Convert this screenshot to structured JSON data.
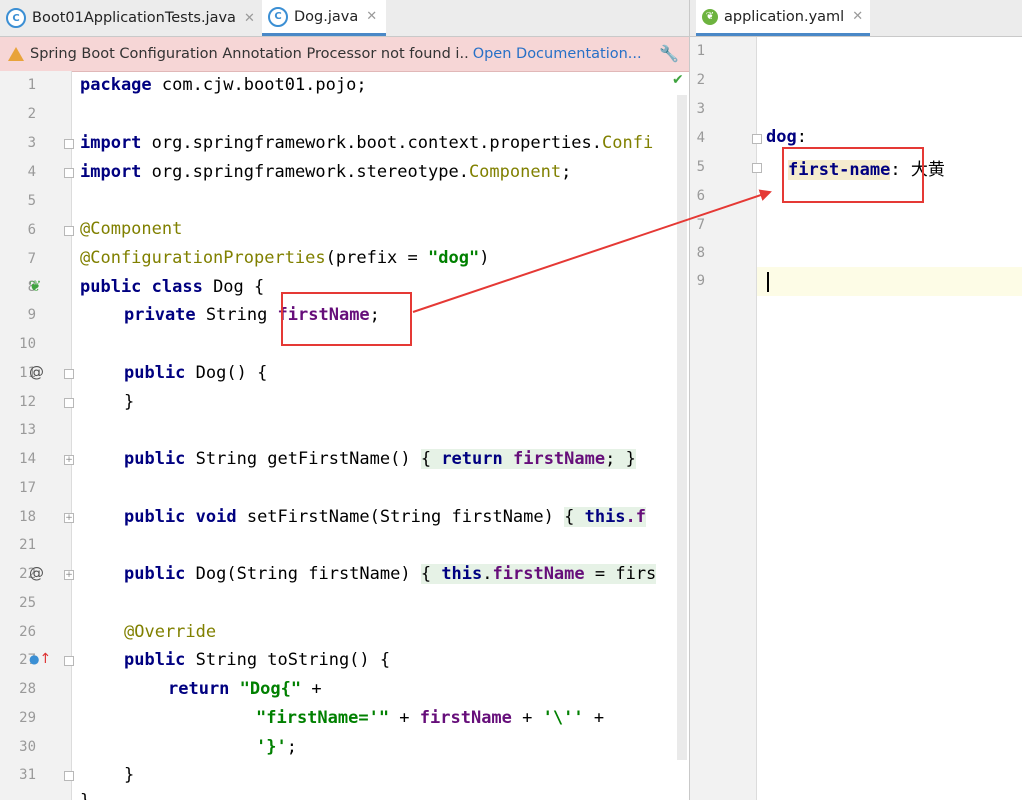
{
  "left_tabs": [
    {
      "label": "Boot01ApplicationTests.java",
      "icon": "class-icon",
      "active": false
    },
    {
      "label": "Dog.java",
      "icon": "class-icon",
      "active": true
    }
  ],
  "right_tabs": [
    {
      "label": "application.yaml",
      "icon": "spring-leaf-icon",
      "active": true
    }
  ],
  "notification": {
    "message": "Spring Boot Configuration Annotation Processor not found i..",
    "link": "Open Documentation..."
  },
  "left_lines": [
    "1",
    "2",
    "3",
    "4",
    "5",
    "6",
    "7",
    "8",
    "9",
    "10",
    "11",
    "12",
    "13",
    "14",
    "17",
    "18",
    "21",
    "22",
    "25",
    "26",
    "27",
    "28",
    "29",
    "30",
    "31"
  ],
  "code": {
    "l1a": "package",
    "l1b": " com.cjw.boot01.pojo;",
    "l3a": "import",
    "l3b": " org.springframework.boot.context.properties.",
    "l3c": "Confi",
    "l4a": "import",
    "l4b": " org.springframework.stereotype.",
    "l4c": "Component",
    "l4d": ";",
    "l6": "@Component",
    "l7a": "@ConfigurationProperties",
    "l7b": "(prefix = ",
    "l7c": "\"dog\"",
    "l7d": ")",
    "l8a": "public class",
    "l8b": " Dog {",
    "l9a": "private",
    "l9b": " String ",
    "l9c": "firstName",
    "l9d": ";",
    "l11a": "public",
    "l11b": " Dog() {",
    "l12": "}",
    "l14a": "public",
    "l14b": " String getFirstName() ",
    "l14c": "{ ",
    "l14d": "return",
    "l14e": " ",
    "l14f": "firstName",
    "l14g": "; }",
    "l18a": "public void",
    "l18b": " setFirstName(String firstName) ",
    "l18c": "{ ",
    "l18d": "this",
    "l18e": ".f",
    "l22a": "public",
    "l22b": " Dog(String firstName) ",
    "l22c": "{ ",
    "l22d": "this",
    "l22e": ".",
    "l22f": "firstName",
    "l22g": " = firs",
    "l26": "@Override",
    "l27a": "public",
    "l27b": " String toString() {",
    "l28a": "return",
    "l28b": " ",
    "l28c": "\"Dog{\"",
    "l28d": " +",
    "l29a": "\"firstName='\"",
    "l29b": " + ",
    "l29c": "firstName",
    "l29d": " + ",
    "l29e": "'\\''",
    "l29f": " +",
    "l30a": "'}'",
    "l30b": ";",
    "l31": "}",
    "l32": "}"
  },
  "right_lines": [
    "1",
    "2",
    "3",
    "4",
    "5",
    "6",
    "7",
    "8",
    "9"
  ],
  "yaml": {
    "dog_key": "dog",
    "colon": ":",
    "first_name_key": "first-name",
    "first_name_value": "大黄"
  },
  "colors": {
    "keyword": "#000080",
    "annotation": "#808000",
    "string": "#008000",
    "field": "#660e7a",
    "highlight_box": "#e53935"
  }
}
